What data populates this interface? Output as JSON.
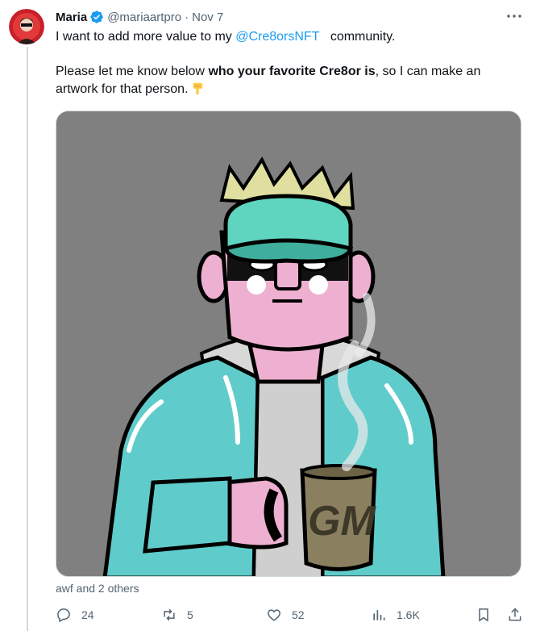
{
  "tweet": {
    "author_name": "Maria",
    "handle": "@mariaartpro",
    "separator": "·",
    "date": "Nov 7",
    "text_line1_prefix": "I want to add more value to my ",
    "mention": "@Cre8orsNFT",
    "text_line1_suffix": "community.",
    "text_p2_prefix": "Please let me know below ",
    "text_p2_bold": "who your favorite Cre8or is",
    "text_p2_suffix": ", so I can make an artwork for that person.",
    "emoji": "backhand-index-pointing-down",
    "media_image_mug_text": "GM",
    "tagged_people": "awf and 2 others"
  },
  "actions": {
    "replies": "24",
    "reposts": "5",
    "likes": "52",
    "views": "1.6K"
  },
  "colors": {
    "link": "#1d9bf0",
    "muted": "#536471",
    "verified": "#1d9bf0"
  }
}
